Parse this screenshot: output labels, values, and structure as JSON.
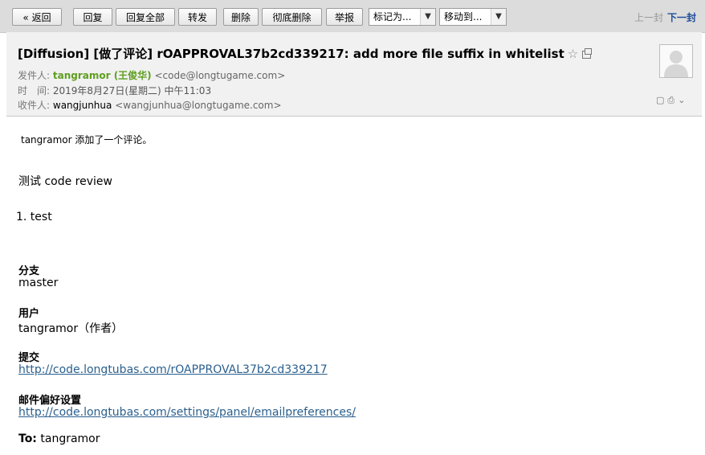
{
  "toolbar": {
    "back": "« 返回",
    "reply": "回复",
    "reply_all": "回复全部",
    "forward": "转发",
    "delete": "删除",
    "delete_perm": "彻底删除",
    "report": "举报",
    "mark_as": "标记为...",
    "move_to": "移动到...",
    "prev": "上一封",
    "next": "下一封"
  },
  "header": {
    "subject": "[Diffusion] [做了评论] rOAPPROVAL37b2cd339217: add more file suffix in whitelist",
    "from_label": "发件人:",
    "from_name": "tangramor (王俊华)",
    "from_addr": "<code@longtugame.com>",
    "time_label": "时　间:",
    "time_value": "2019年8月27日(星期二) 中午11:03",
    "to_label": "收件人:",
    "to_name": "wangjunhua",
    "to_addr": "<wangjunhua@longtugame.com>"
  },
  "body": {
    "comment_line": "tangramor 添加了一个评论。",
    "review_line": "测试 code review",
    "list_item": "1. test",
    "branch_label": "分支",
    "branch_value": "master",
    "user_label": "用户",
    "user_value": "tangramor（作者）",
    "commit_label": "提交",
    "commit_link": "http://code.longtubas.com/rOAPPROVAL37b2cd339217",
    "prefs_label": "邮件偏好设置",
    "prefs_link": "http://code.longtubas.com/settings/panel/emailpreferences/",
    "to_label": "To:",
    "to_value": "tangramor"
  },
  "colors": {
    "toolbar_bg": "#dcdcdc",
    "header_bg": "#f1f1f1",
    "sender_green": "#5f9e1f",
    "link_blue": "#2a5f8e",
    "next_blue": "#1f4e9a"
  }
}
